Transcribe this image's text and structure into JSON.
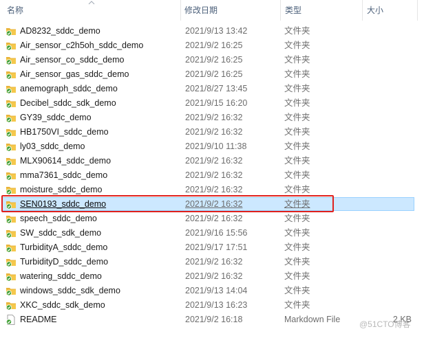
{
  "columns": {
    "name": "名称",
    "date": "修改日期",
    "type": "类型",
    "size": "大小"
  },
  "rows": [
    {
      "name": "AD8232_sddc_demo",
      "date": "2021/9/13 13:42",
      "type": "文件夹",
      "size": "",
      "icon": "folder-sync-icon"
    },
    {
      "name": "Air_sensor_c2h5oh_sddc_demo",
      "date": "2021/9/2 16:25",
      "type": "文件夹",
      "size": "",
      "icon": "folder-sync-icon"
    },
    {
      "name": "Air_sensor_co_sddc_demo",
      "date": "2021/9/2 16:25",
      "type": "文件夹",
      "size": "",
      "icon": "folder-sync-icon"
    },
    {
      "name": "Air_sensor_gas_sddc_demo",
      "date": "2021/9/2 16:25",
      "type": "文件夹",
      "size": "",
      "icon": "folder-sync-icon"
    },
    {
      "name": "anemograph_sddc_demo",
      "date": "2021/8/27 13:45",
      "type": "文件夹",
      "size": "",
      "icon": "folder-sync-icon"
    },
    {
      "name": "Decibel_sddc_sdk_demo",
      "date": "2021/9/15 16:20",
      "type": "文件夹",
      "size": "",
      "icon": "folder-sync-icon"
    },
    {
      "name": "GY39_sddc_demo",
      "date": "2021/9/2 16:32",
      "type": "文件夹",
      "size": "",
      "icon": "folder-sync-icon"
    },
    {
      "name": "HB1750VI_sddc_demo",
      "date": "2021/9/2 16:32",
      "type": "文件夹",
      "size": "",
      "icon": "folder-sync-icon"
    },
    {
      "name": "ly03_sddc_demo",
      "date": "2021/9/10 11:38",
      "type": "文件夹",
      "size": "",
      "icon": "folder-sync-icon"
    },
    {
      "name": "MLX90614_sddc_demo",
      "date": "2021/9/2 16:32",
      "type": "文件夹",
      "size": "",
      "icon": "folder-sync-icon"
    },
    {
      "name": "mma7361_sddc_demo",
      "date": "2021/9/2 16:32",
      "type": "文件夹",
      "size": "",
      "icon": "folder-sync-icon"
    },
    {
      "name": "moisture_sddc_demo",
      "date": "2021/9/2 16:32",
      "type": "文件夹",
      "size": "",
      "icon": "folder-sync-icon"
    },
    {
      "name": "SEN0193_sddc_demo",
      "date": "2021/9/2 16:32",
      "type": "文件夹",
      "size": "",
      "icon": "folder-sync-icon",
      "selected": true
    },
    {
      "name": "speech_sddc_demo",
      "date": "2021/9/2 16:32",
      "type": "文件夹",
      "size": "",
      "icon": "folder-sync-icon"
    },
    {
      "name": "SW_sddc_sdk_demo",
      "date": "2021/9/16 15:56",
      "type": "文件夹",
      "size": "",
      "icon": "folder-sync-icon"
    },
    {
      "name": "TurbidityA_sddc_demo",
      "date": "2021/9/17 17:51",
      "type": "文件夹",
      "size": "",
      "icon": "folder-sync-icon"
    },
    {
      "name": "TurbidityD_sddc_demo",
      "date": "2021/9/2 16:32",
      "type": "文件夹",
      "size": "",
      "icon": "folder-sync-icon"
    },
    {
      "name": "watering_sddc_demo",
      "date": "2021/9/2 16:32",
      "type": "文件夹",
      "size": "",
      "icon": "folder-sync-icon"
    },
    {
      "name": "windows_sddc_sdk_demo",
      "date": "2021/9/13 14:04",
      "type": "文件夹",
      "size": "",
      "icon": "folder-sync-icon"
    },
    {
      "name": "XKC_sddc_sdk_demo",
      "date": "2021/9/13 16:23",
      "type": "文件夹",
      "size": "",
      "icon": "folder-sync-icon"
    },
    {
      "name": "README",
      "date": "2021/9/2 16:18",
      "type": "Markdown File",
      "size": "2 KB",
      "icon": "file-sync-icon"
    }
  ],
  "watermark": "@51CTO博客",
  "colors": {
    "selection_bg": "#cce8ff",
    "selection_border": "#99d1ff",
    "highlight_box": "#e0201c",
    "folder": "#f5c84c",
    "sync_check": "#3b9d2f"
  }
}
